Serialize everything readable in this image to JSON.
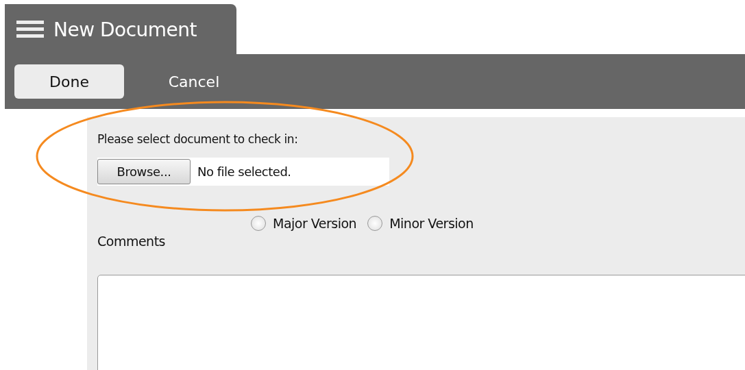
{
  "header": {
    "title": "New Document"
  },
  "toolbar": {
    "buttons": [
      {
        "label": "Done",
        "kind": "primary"
      },
      {
        "label": "Cancel",
        "kind": "plain"
      }
    ]
  },
  "form": {
    "prompt": "Please select document to check in:",
    "browse_button": "Browse...",
    "file_status": "No file selected.",
    "versions": [
      {
        "label": "Major Version",
        "selected": false
      },
      {
        "label": "Minor Version",
        "selected": false
      }
    ],
    "comments_label": "Comments"
  }
}
